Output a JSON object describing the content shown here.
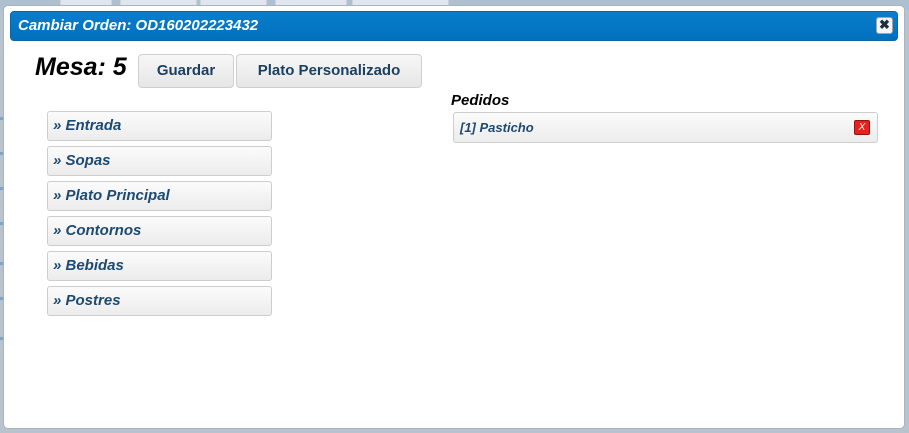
{
  "dialog": {
    "title": "Cambiar Orden: OD160202223432",
    "close_icon": "close-icon"
  },
  "header": {
    "mesa": "Mesa: 5",
    "guardar_label": "Guardar",
    "plato_personalizado_label": "Plato Personalizado"
  },
  "categories": [
    {
      "label": "» Entrada"
    },
    {
      "label": "» Sopas"
    },
    {
      "label": "» Plato Principal"
    },
    {
      "label": "» Contornos"
    },
    {
      "label": "» Bebidas"
    },
    {
      "label": "» Postres"
    }
  ],
  "pedidos": {
    "title": "Pedidos",
    "items": [
      {
        "label": "[1] Pasticho",
        "remove_label": "X"
      }
    ]
  },
  "colors": {
    "titlebar": "#0070bd",
    "category_text": "#1d4a72",
    "remove": "#e8211c"
  }
}
